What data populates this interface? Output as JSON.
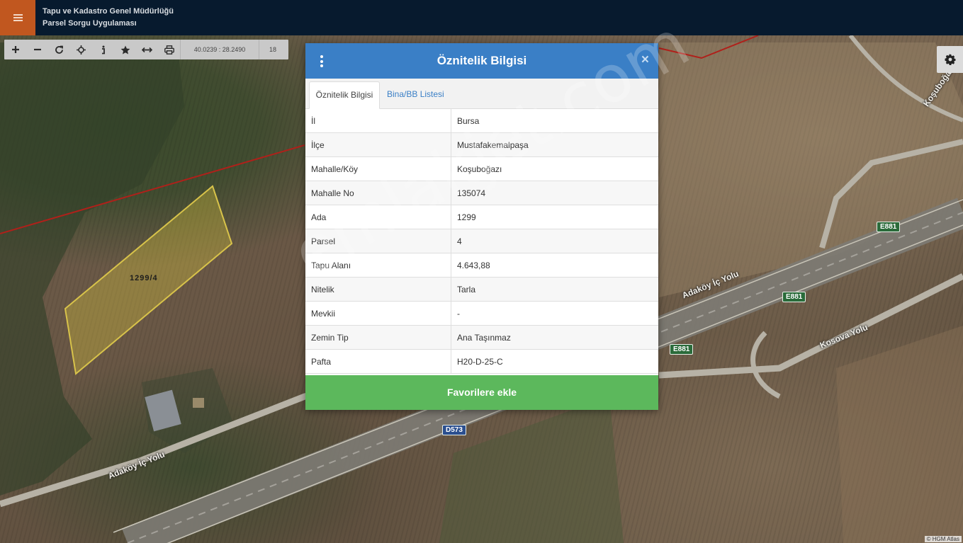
{
  "header": {
    "org_name": "Tapu ve Kadastro Genel Müdürlüğü",
    "app_name": "Parsel Sorgu Uygulaması",
    "menu_icon": "hamburger-icon",
    "menu_color": "#c1571f",
    "bar_color": "#071a2e"
  },
  "toolbar": {
    "buttons": [
      {
        "name": "zoom-in",
        "icon": "plus-icon"
      },
      {
        "name": "zoom-out",
        "icon": "minus-icon"
      },
      {
        "name": "refresh",
        "icon": "refresh-icon"
      },
      {
        "name": "locate",
        "icon": "crosshair-icon"
      },
      {
        "name": "info",
        "icon": "info-icon"
      },
      {
        "name": "favorites",
        "icon": "star-icon"
      },
      {
        "name": "measure",
        "icon": "arrows-horizontal-icon"
      },
      {
        "name": "print",
        "icon": "printer-icon"
      }
    ],
    "coordinates": "40.0239 : 28.2490",
    "zoom_level": "18"
  },
  "settings_icon": "gear-icon",
  "map": {
    "parcel_label": "1299/4",
    "labels": [
      "Adaköy İç Yolu",
      "Adaköy İç Yolu",
      "Kosova Yolu",
      "Koşuboğazı"
    ],
    "shields": [
      "E881",
      "E881",
      "E881",
      "D573"
    ],
    "attribution": "© HGM Atlas"
  },
  "modal": {
    "title": "Öznitelik Bilgisi",
    "close_symbol": "×",
    "header_color": "#3a7fc6",
    "tabs": [
      {
        "label": "Öznitelik Bilgisi",
        "active": true
      },
      {
        "label": "Bina/BB Listesi",
        "active": false
      }
    ],
    "rows": [
      {
        "key": "İl",
        "value": "Bursa"
      },
      {
        "key": "İlçe",
        "value": "Mustafakemalpaşa"
      },
      {
        "key": "Mahalle/Köy",
        "value": "Koşuboğazı"
      },
      {
        "key": "Mahalle No",
        "value": "135074"
      },
      {
        "key": "Ada",
        "value": "1299"
      },
      {
        "key": "Parsel",
        "value": "4"
      },
      {
        "key": "Tapu Alanı",
        "value": "4.643,88"
      },
      {
        "key": "Nitelik",
        "value": "Tarla"
      },
      {
        "key": "Mevkii",
        "value": "-"
      },
      {
        "key": "Zemin Tip",
        "value": "Ana Taşınmaz"
      },
      {
        "key": "Pafta",
        "value": "H20-D-25-C"
      }
    ],
    "favorite_button": "Favorilere ekle",
    "favorite_color": "#5cb85c"
  },
  "watermark": "emlakjet.com"
}
